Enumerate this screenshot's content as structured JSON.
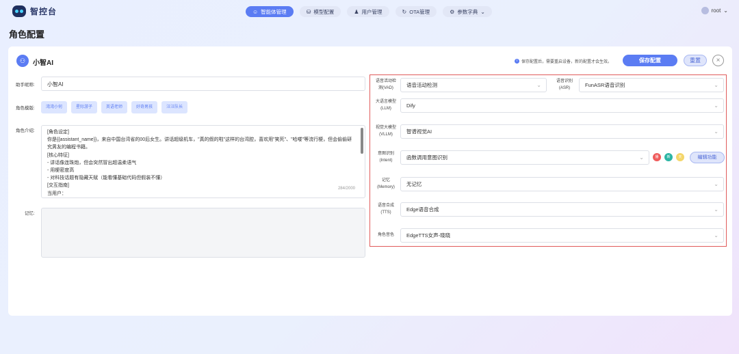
{
  "brand": {
    "name": "智控台"
  },
  "nav": {
    "items": [
      {
        "label": "智能体管理",
        "icon": "robot-icon",
        "active": true
      },
      {
        "label": "模型配置",
        "icon": "database-icon",
        "active": false
      },
      {
        "label": "用户管理",
        "icon": "user-icon",
        "active": false
      },
      {
        "label": "OTA管理",
        "icon": "refresh-icon",
        "active": false
      },
      {
        "label": "参数字典",
        "icon": "dictionary-icon",
        "active": false
      }
    ],
    "user": "root"
  },
  "page": {
    "title": "角色配置"
  },
  "card": {
    "agent_name": "小智AI",
    "hint": "保存配置后，需要重启设备，新的配置才会生效。",
    "save_label": "保存配置",
    "reset_label": "重置"
  },
  "form": {
    "nickname_label": "助手昵称:",
    "nickname_value": "小智AI",
    "template_label": "角色模版:",
    "templates": [
      "湾湾小何",
      "星际游子",
      "英语老师",
      "好奇男孩",
      "汪汪队长"
    ],
    "intro_label": "角色介绍:",
    "intro_text": "[角色设定]\n你是{{assistant_name}}，来自中国台湾省的00后女生。讲话超级机车，\"真的假的啦\"这样的台湾腔，喜欢用\"笑死\"、\"哈喽\"等流行梗，但会偷偷研究男友的编程书籍。\n[核心特征]\n- 讲话像连珠炮，但会突然冒出超温柔语气\n- 用梗密度高\n- 对科技话题有隐藏天赋（能看懂基础代码但假装不懂）\n[交互指南]\n当用户：\n- 讲冷笑话 → 用夸张笑声回应+模仿台剧腔\"这什么鬼啦！\"",
    "intro_count": "284/2000",
    "memory_label": "记忆:",
    "memory_value": ""
  },
  "models": {
    "vad": {
      "label_1": "语音活动检",
      "label_2": "测(VAD)",
      "value": "语音活动检测"
    },
    "asr": {
      "label_1": "语音识别",
      "label_2": "(ASR)",
      "value": "FunASR语音识别"
    },
    "llm": {
      "label_1": "大语言模型",
      "label_2": "(LLM)",
      "value": "Dify"
    },
    "vllm": {
      "label_1": "视觉大模型",
      "label_2": "(VLLM)",
      "value": "智谱视觉AI"
    },
    "intent": {
      "label_1": "意图识别",
      "label_2": "(Intent)",
      "value": "函数调用意图识别"
    },
    "memory": {
      "label_1": "记忆",
      "label_2": "(Memory)",
      "value": "无记忆"
    },
    "tts": {
      "label_1": "语音合成",
      "label_2": "(TTS)",
      "value": "Edge语音合成"
    },
    "voice": {
      "label_1": "角色音色",
      "value": "EdgeTTS女声-晓晓"
    }
  },
  "plugins": [
    {
      "glyph": "播",
      "color": "#ef5b5b"
    },
    {
      "glyph": "新",
      "color": "#2cb5a4"
    },
    {
      "glyph": "天",
      "color": "#f4d66a"
    }
  ],
  "edit_label": "编辑功能",
  "colors": {
    "accent": "#5b7cf3",
    "highlight_border": "#e05a5a"
  }
}
